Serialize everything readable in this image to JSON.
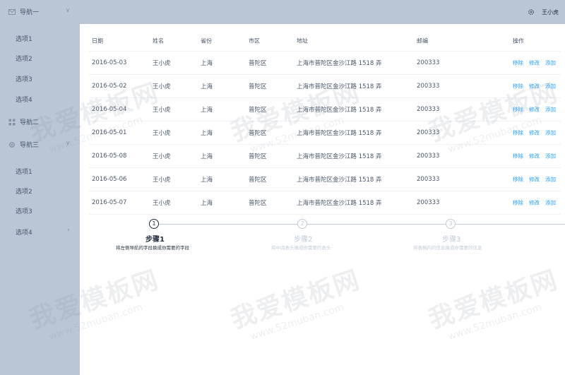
{
  "sidebar": {
    "groups": [
      {
        "label": "导航一",
        "icon": "mail-icon",
        "chevron": "∨"
      },
      {
        "label": "导航二",
        "icon": "grid-icon"
      },
      {
        "label": "导航三",
        "icon": "gear-icon",
        "chevron": "∨"
      }
    ],
    "group1_items": [
      "选项1",
      "选项2",
      "选项3",
      "选项4"
    ],
    "group3_items": [
      "选项1",
      "选项2",
      "选项3",
      "选项4"
    ],
    "group3_item4_chevron": "›"
  },
  "header": {
    "user": "王小虎",
    "icon": "settings-icon"
  },
  "table": {
    "columns": [
      "日期",
      "姓名",
      "省份",
      "市区",
      "地址",
      "邮编",
      "操作"
    ],
    "rows": [
      {
        "date": "2016-05-03",
        "name": "王小虎",
        "province": "上海",
        "city": "普陀区",
        "address": "上海市普陀区金沙江路 1518 弄",
        "zip": "200333"
      },
      {
        "date": "2016-05-02",
        "name": "王小虎",
        "province": "上海",
        "city": "普陀区",
        "address": "上海市普陀区金沙江路 1518 弄",
        "zip": "200333"
      },
      {
        "date": "2016-05-04",
        "name": "王小虎",
        "province": "上海",
        "city": "普陀区",
        "address": "上海市普陀区金沙江路 1518 弄",
        "zip": "200333"
      },
      {
        "date": "2016-05-01",
        "name": "王小虎",
        "province": "上海",
        "city": "普陀区",
        "address": "上海市普陀区金沙江路 1518 弄",
        "zip": "200333"
      },
      {
        "date": "2016-05-08",
        "name": "王小虎",
        "province": "上海",
        "city": "普陀区",
        "address": "上海市普陀区金沙江路 1518 弄",
        "zip": "200333"
      },
      {
        "date": "2016-05-06",
        "name": "王小虎",
        "province": "上海",
        "city": "普陀区",
        "address": "上海市普陀区金沙江路 1518 弄",
        "zip": "200333"
      },
      {
        "date": "2016-05-07",
        "name": "王小虎",
        "province": "上海",
        "city": "普陀区",
        "address": "上海市普陀区金沙江路 1518 弄",
        "zip": "200333"
      }
    ],
    "actions": [
      "移除",
      "修改",
      "添加"
    ]
  },
  "steps": [
    {
      "number": "1",
      "title": "步骤1",
      "description": "将左侧导航的字段换成你需要的字段",
      "active": true
    },
    {
      "number": "2",
      "title": "步骤2",
      "description": "将中间表头换成你需要的表头",
      "active": false
    },
    {
      "number": "3",
      "title": "步骤3",
      "description": "将表格内的信息换成你需要的信息",
      "active": false
    }
  ],
  "watermark": {
    "text": "我爱模板网",
    "url": "www.52muban.com"
  },
  "colors": {
    "sidebar": "#bac6d6",
    "link": "#20a0ff",
    "text": "#48576a"
  }
}
